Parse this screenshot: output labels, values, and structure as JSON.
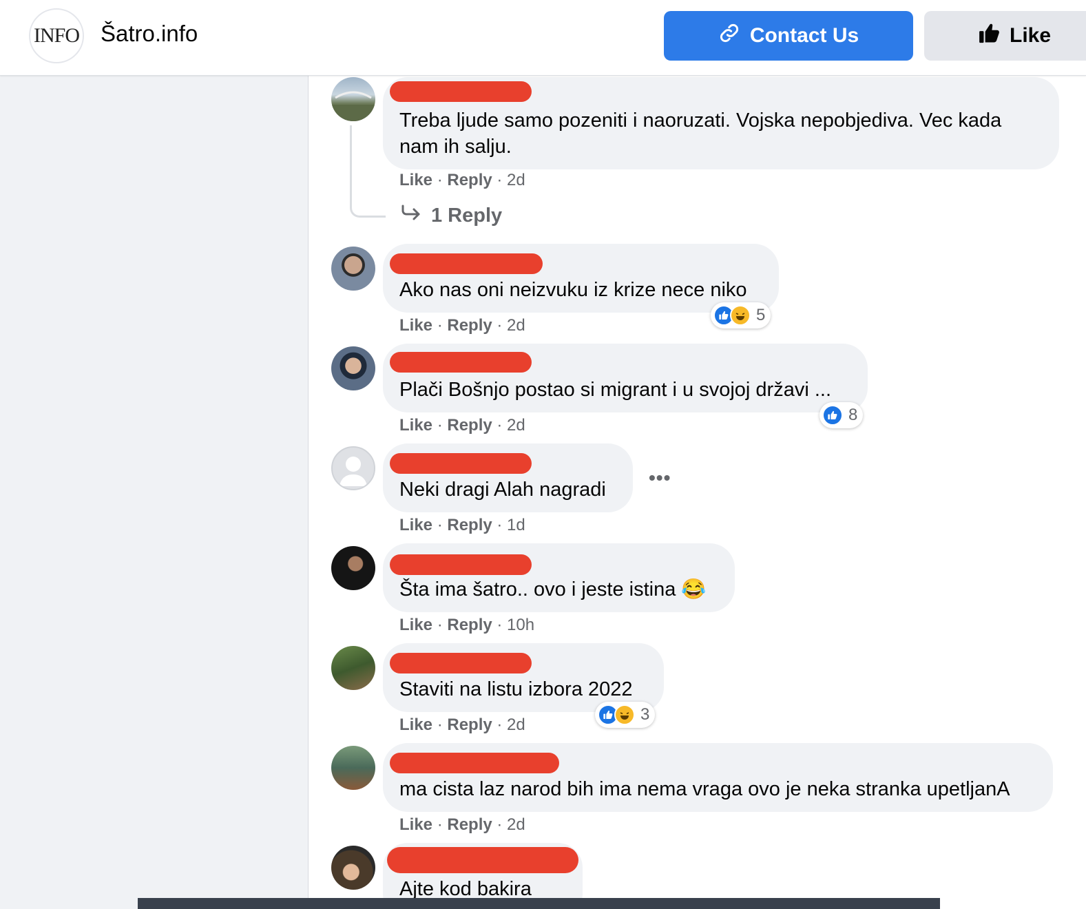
{
  "page": {
    "logo_text": "INFO",
    "title": "Šatro.info",
    "contact_label": "Contact Us",
    "like_label": "Like"
  },
  "comments": [
    {
      "text_line1": "Treba ljude samo pozeniti i naoruzati. Vojska nepobjediva. Vec kada",
      "text_line2": "nam ih salju.",
      "like": "Like",
      "reply": "Reply",
      "time": "2d",
      "replies_label": "1 Reply"
    },
    {
      "text": "Ako nas oni neizvuku iz krize nece niko",
      "like": "Like",
      "reply": "Reply",
      "time": "2d",
      "reaction_count": "5"
    },
    {
      "text": "Plači Bošnjo postao si migrant i u svojoj državi ...",
      "like": "Like",
      "reply": "Reply",
      "time": "2d",
      "reaction_count": "8"
    },
    {
      "text": "Neki dragi Alah nagradi",
      "like": "Like",
      "reply": "Reply",
      "time": "1d",
      "more": "•••"
    },
    {
      "text": "Šta ima šatro.. ovo i jeste istina 😂",
      "like": "Like",
      "reply": "Reply",
      "time": "10h"
    },
    {
      "text": "Staviti na listu izbora 2022",
      "like": "Like",
      "reply": "Reply",
      "time": "2d",
      "reaction_count": "3"
    },
    {
      "text": "ma cista laz narod bih ima nema vraga ovo je neka stranka upetljanA",
      "like": "Like",
      "reply": "Reply",
      "time": "2d"
    },
    {
      "text": "Ajte kod bakira"
    }
  ],
  "icons": {
    "link": "link-icon",
    "thumbs_up": "thumbs-up-icon",
    "reply_arrow": "reply-arrow-icon",
    "like_reaction": "like-reaction-icon",
    "haha_reaction": "haha-reaction-icon",
    "more": "more-options-icon"
  },
  "colors": {
    "accent": "#2d7be8",
    "redaction": "#e8402d",
    "bubble": "#f0f2f5",
    "meta_text": "#65676b"
  }
}
